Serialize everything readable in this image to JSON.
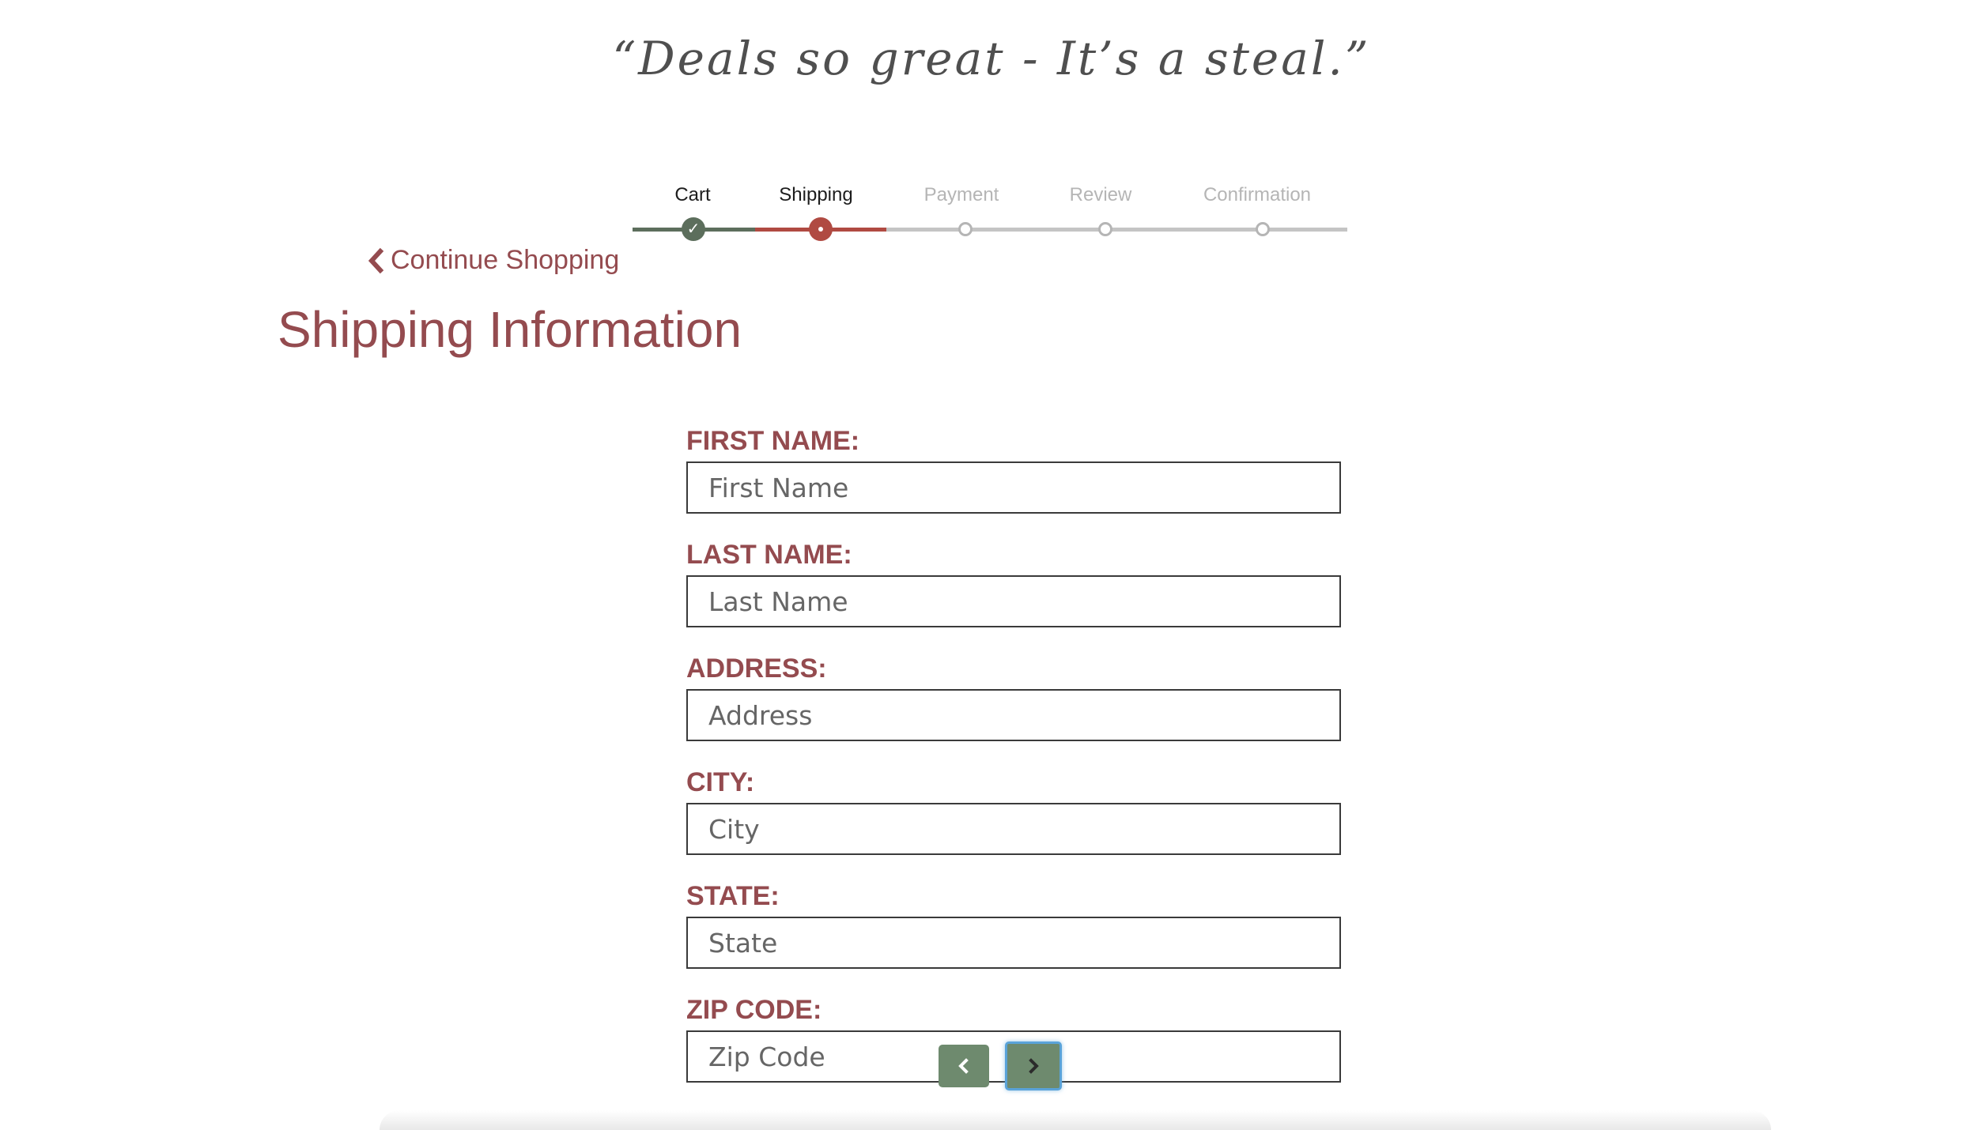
{
  "tagline": "“Deals so great - It’s a steal.”",
  "stepper": {
    "steps": [
      {
        "label": "Cart",
        "status": "done"
      },
      {
        "label": "Shipping",
        "status": "active"
      },
      {
        "label": "Payment",
        "status": "todo"
      },
      {
        "label": "Review",
        "status": "todo"
      },
      {
        "label": "Confirmation",
        "status": "todo"
      }
    ],
    "check_glyph": "✓"
  },
  "continue_shopping": {
    "label": "Continue Shopping",
    "icon": "chevron-left-icon"
  },
  "page_title": "Shipping Information",
  "form": {
    "fields": [
      {
        "label": "FIRST NAME:",
        "placeholder": "First Name",
        "value": ""
      },
      {
        "label": "LAST NAME:",
        "placeholder": "Last Name",
        "value": ""
      },
      {
        "label": "ADDRESS:",
        "placeholder": "Address",
        "value": ""
      },
      {
        "label": "CITY:",
        "placeholder": "City",
        "value": ""
      },
      {
        "label": "STATE:",
        "placeholder": "State",
        "value": ""
      },
      {
        "label": "ZIP CODE:",
        "placeholder": "Zip Code",
        "value": ""
      }
    ]
  },
  "nav": {
    "prev_icon": "chevron-left-icon",
    "next_icon": "chevron-right-icon"
  },
  "colors": {
    "accent": "#944b4f",
    "done_green": "#5c6e5c",
    "active_red": "#b04a42",
    "inactive_gray": "#b5b5b5",
    "button_green": "#6e8a6e",
    "focus_blue": "#5aa3d9"
  }
}
